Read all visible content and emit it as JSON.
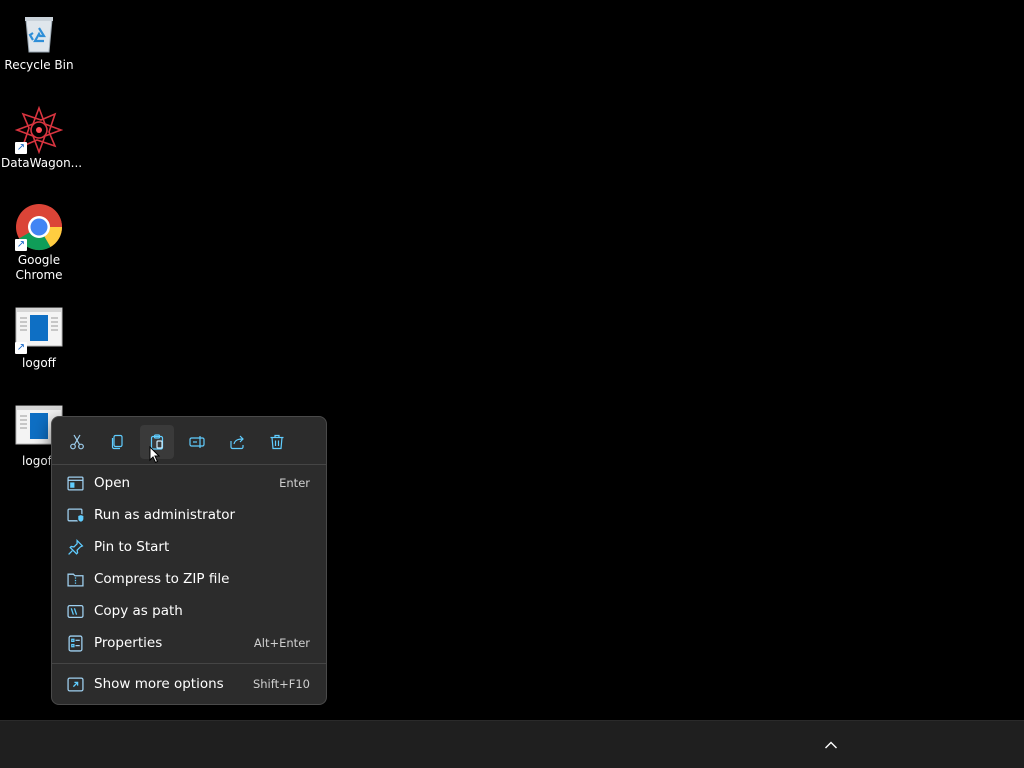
{
  "desktop": {
    "icons": [
      {
        "label": "Recycle Bin",
        "icon": "recycle-bin-icon"
      },
      {
        "label": "DataWagon...",
        "icon": "datawagon-icon"
      },
      {
        "label": "Google Chrome",
        "icon": "chrome-icon"
      },
      {
        "label": "logoff",
        "icon": "script-file-icon"
      },
      {
        "label": "logoff",
        "icon": "script-file-icon"
      }
    ]
  },
  "context_menu": {
    "toolbar": [
      {
        "name": "cut",
        "icon": "scissors-icon"
      },
      {
        "name": "copy",
        "icon": "copy-icon"
      },
      {
        "name": "paste",
        "icon": "clipboard-icon"
      },
      {
        "name": "rename",
        "icon": "rename-icon"
      },
      {
        "name": "share",
        "icon": "share-icon"
      },
      {
        "name": "delete",
        "icon": "trash-icon"
      }
    ],
    "items": [
      {
        "label": "Open",
        "shortcut": "Enter",
        "icon": "open-window-icon"
      },
      {
        "label": "Run as administrator",
        "shortcut": "",
        "icon": "admin-shield-icon"
      },
      {
        "label": "Pin to Start",
        "shortcut": "",
        "icon": "pin-icon"
      },
      {
        "label": "Compress to ZIP file",
        "shortcut": "",
        "icon": "zip-folder-icon"
      },
      {
        "label": "Copy as path",
        "shortcut": "",
        "icon": "copy-path-icon"
      },
      {
        "label": "Properties",
        "shortcut": "Alt+Enter",
        "icon": "properties-icon"
      },
      {
        "label": "Show more options",
        "shortcut": "Shift+F10",
        "icon": "more-options-icon"
      }
    ]
  },
  "taskbar": {
    "tray_icon": "chevron-up-icon"
  },
  "colors": {
    "accent": "#60cdff",
    "menu_bg": "#2c2c2c",
    "taskbar_bg": "#1f1f1f"
  }
}
